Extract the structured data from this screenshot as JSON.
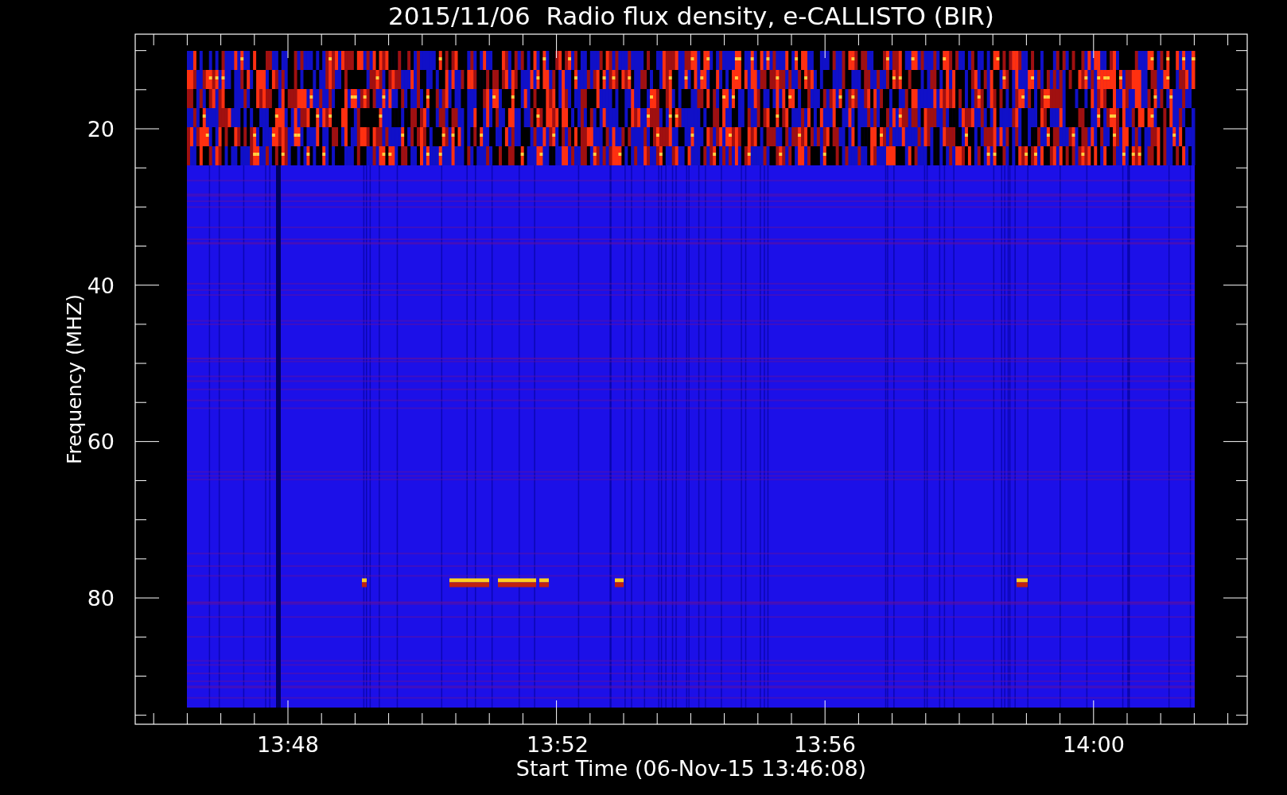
{
  "title": "2015/11/06  Radio flux density, e-CALLISTO (BIR)",
  "y_axis": {
    "label": "Frequency (MHZ)",
    "ticks": [
      "20",
      "40",
      "60",
      "80"
    ]
  },
  "x_axis": {
    "label": "Start Time (06-Nov-15 13:46:08)",
    "ticks": [
      "13:48",
      "13:52",
      "13:56",
      "14:00"
    ]
  }
}
